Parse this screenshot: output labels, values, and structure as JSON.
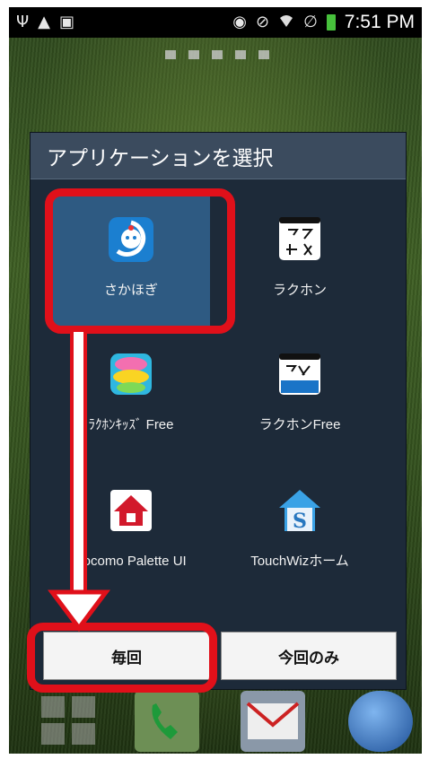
{
  "status_bar": {
    "time": "7:51 PM",
    "left_icons": [
      "usb-icon",
      "warning-icon",
      "clipboard-icon"
    ],
    "right_icons": [
      "eye-icon",
      "mute-icon",
      "wifi-icon",
      "no-sim-icon",
      "battery-icon"
    ]
  },
  "dialog": {
    "title": "アプリケーションを選択",
    "apps": [
      {
        "label": "さかほぎ",
        "icon": "sakahogi-icon",
        "selected": true
      },
      {
        "label": "ラクホン",
        "icon": "rakuhon-icon",
        "selected": false
      },
      {
        "label": "ﾗｸﾎﾝｷｯｽﾞ Free",
        "icon": "rakuhon-kids-free-icon",
        "selected": false
      },
      {
        "label": "ラクホンFree",
        "icon": "rakuhon-free-icon",
        "selected": false
      },
      {
        "label": "docomo Palette UI",
        "icon": "docomo-palette-icon",
        "selected": false
      },
      {
        "label": "TouchWizホーム",
        "icon": "touchwiz-home-icon",
        "selected": false
      }
    ],
    "always_button": "毎回",
    "just_once_button": "今回のみ"
  },
  "dock": [
    "apps-grid-icon",
    "phone-icon",
    "mail-icon",
    "globe-icon"
  ],
  "colors": {
    "dialog_bg": "#1d2a39",
    "header_bg": "#3b4b5e",
    "selected_bg": "#2e5a82",
    "annotation_red": "#e0101a"
  }
}
